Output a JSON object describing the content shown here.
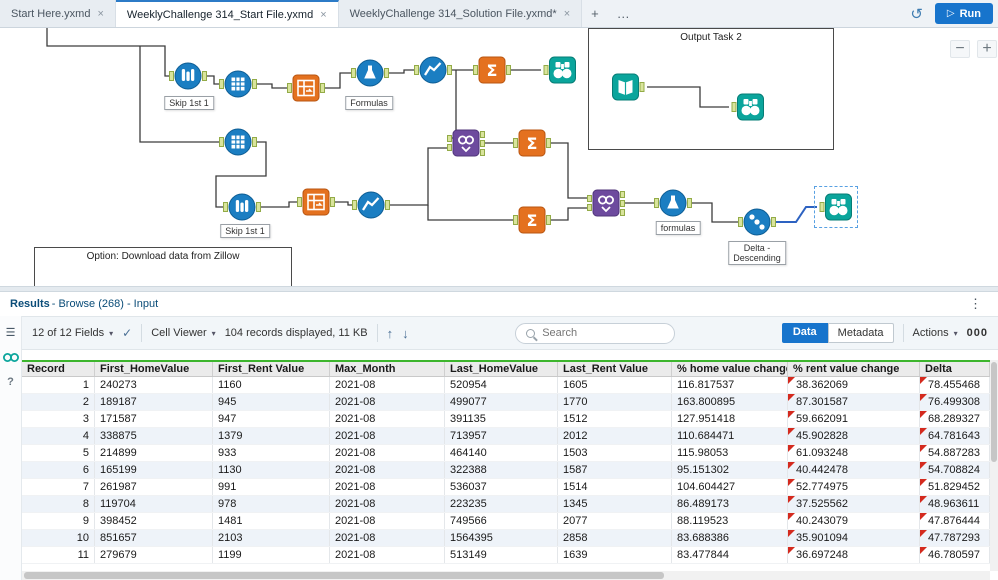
{
  "glyphs": {
    "close": "×",
    "plus": "+",
    "more": "…",
    "caret": "▾",
    "check": "✓",
    "up": "↑",
    "down": "↓",
    "kebab": "⋮",
    "minus": "−",
    "play": "▷",
    "history": "↺",
    "menu": "☰",
    "help": "?",
    "sigma": "Σ"
  },
  "tab_bar": {
    "tabs": [
      {
        "label": "Start Here.yxmd"
      },
      {
        "label": "WeeklyChallenge 314_Start File.yxmd"
      },
      {
        "label": "WeeklyChallenge 314_Solution File.yxmd*"
      }
    ],
    "run_label": "Run"
  },
  "canvas": {
    "container_label": "Output Task 2",
    "comment_text": "Option: Download data from Zillow",
    "labels": {
      "sample1": "Skip 1st 1",
      "formula1": "Formulas",
      "sample2": "Skip 1st 1",
      "formula2": "formulas",
      "sort1_line1": "Delta -",
      "sort1_line2": "Descending"
    }
  },
  "results": {
    "title": "Results",
    "subtitle": " - Browse (268) - Input",
    "toolbar": {
      "fields": "12 of 12 Fields",
      "cell_viewer": "Cell Viewer",
      "records": "104 records displayed, 11 KB",
      "search_placeholder": "Search",
      "data_label": "Data",
      "metadata_label": "Metadata",
      "actions_label": "Actions",
      "actions_extra": "000"
    },
    "table": {
      "columns": [
        "Record",
        "First_HomeValue",
        "First_Rent Value",
        "Max_Month",
        "Last_HomeValue",
        "Last_Rent Value",
        "% home value change",
        "% rent value change",
        "Delta"
      ],
      "marker_columns": [
        7,
        8
      ],
      "rows": [
        [
          "1",
          "240273",
          "1160",
          "2021-08",
          "520954",
          "1605",
          "116.817537",
          "38.362069",
          "78.455468"
        ],
        [
          "2",
          "189187",
          "945",
          "2021-08",
          "499077",
          "1770",
          "163.800895",
          "87.301587",
          "76.499308"
        ],
        [
          "3",
          "171587",
          "947",
          "2021-08",
          "391135",
          "1512",
          "127.951418",
          "59.662091",
          "68.289327"
        ],
        [
          "4",
          "338875",
          "1379",
          "2021-08",
          "713957",
          "2012",
          "110.684471",
          "45.902828",
          "64.781643"
        ],
        [
          "5",
          "214899",
          "933",
          "2021-08",
          "464140",
          "1503",
          "115.98053",
          "61.093248",
          "54.887283"
        ],
        [
          "6",
          "165199",
          "1130",
          "2021-08",
          "322388",
          "1587",
          "95.151302",
          "40.442478",
          "54.708824"
        ],
        [
          "7",
          "261987",
          "991",
          "2021-08",
          "536037",
          "1514",
          "104.604427",
          "52.774975",
          "51.829452"
        ],
        [
          "8",
          "119704",
          "978",
          "2021-08",
          "223235",
          "1345",
          "86.489173",
          "37.525562",
          "48.963611"
        ],
        [
          "9",
          "398452",
          "1481",
          "2021-08",
          "749566",
          "2077",
          "88.119523",
          "40.243079",
          "47.876444"
        ],
        [
          "10",
          "851657",
          "2103",
          "2021-08",
          "1564395",
          "2858",
          "83.688386",
          "35.901094",
          "47.787293"
        ],
        [
          "11",
          "279679",
          "1199",
          "2021-08",
          "513149",
          "1639",
          "83.477844",
          "36.697248",
          "46.780597"
        ]
      ]
    }
  }
}
